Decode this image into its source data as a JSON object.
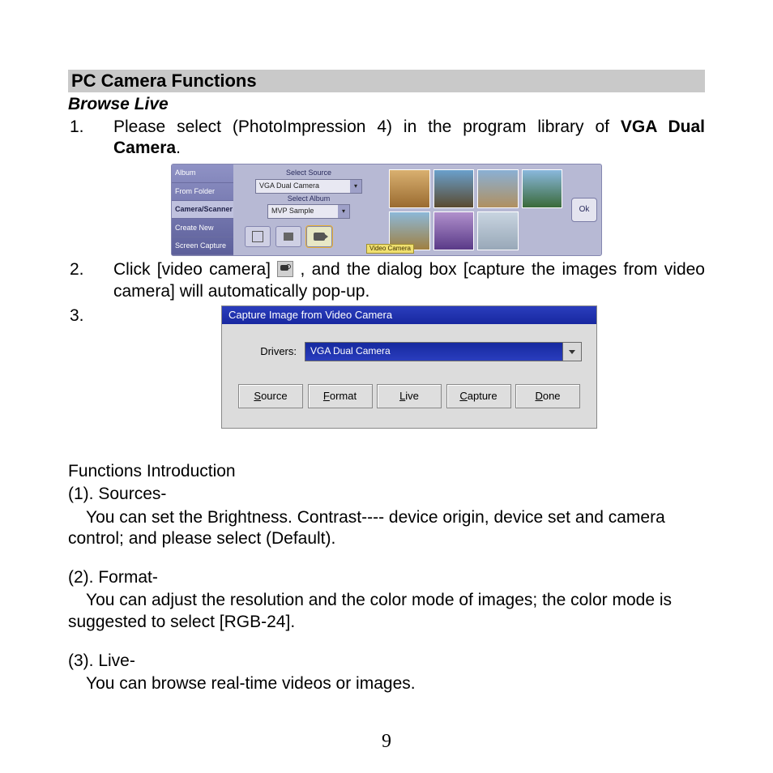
{
  "heading": "PC Camera Functions",
  "subheading": "Browse Live",
  "step1": {
    "num": "1.",
    "pre": "Please select (PhotoImpression 4) in the program library of ",
    "bold": "VGA Dual Camera",
    "post": "."
  },
  "photoimpression": {
    "tabs": [
      "Album",
      "From Folder",
      "Camera/Scanner",
      "Create New",
      "Screen Capture"
    ],
    "active_tab_index": 2,
    "select_source_label": "Select Source",
    "select_source_value": "VGA Dual Camera",
    "select_album_label": "Select Album",
    "select_album_value": "MVP Sample",
    "video_camera_label": "Video Camera",
    "ok": "Ok"
  },
  "step2": {
    "num": "2.",
    "pre": "Click [video camera] ",
    "post": " , and the dialog box [capture the images from video camera] will automatically pop-up."
  },
  "step3": {
    "num": "3."
  },
  "dialog": {
    "title": "Capture Image from Video Camera",
    "drivers_label": "Drivers:",
    "drivers_value": "VGA Dual Camera",
    "buttons": {
      "source": "Source",
      "format": "Format",
      "live": "Live",
      "capture": "Capture",
      "done": "Done"
    },
    "hotkeys": {
      "source": "S",
      "format": "F",
      "live": "L",
      "capture": "C",
      "done": "D"
    }
  },
  "functions": {
    "title": "Functions Introduction",
    "items": [
      {
        "head": " (1). Sources-",
        "body": "You can set the Brightness. Contrast---- device origin, device set and camera control; and please select (Default)."
      },
      {
        "head": "(2). Format-",
        "body": "You can adjust the resolution and the color mode of images; the color mode is suggested to select [RGB-24]."
      },
      {
        "head": "(3). Live-",
        "body": "You can browse real-time videos or images."
      }
    ]
  },
  "page_number": "9"
}
